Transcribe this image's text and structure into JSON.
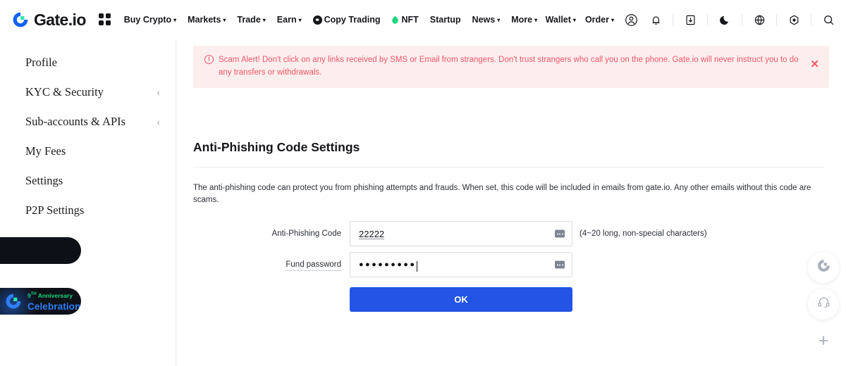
{
  "brand": {
    "name": "Gate.io",
    "logo_icon": "gate-logo-icon"
  },
  "topnav": {
    "apps_icon": "apps-grid-icon",
    "links": [
      {
        "label": "Buy Crypto",
        "caret": "▾",
        "icon": ""
      },
      {
        "label": "Markets",
        "caret": "▾",
        "icon": ""
      },
      {
        "label": "Trade",
        "caret": "▾",
        "icon": ""
      },
      {
        "label": "Earn",
        "caret": "▾",
        "icon": ""
      },
      {
        "label": "Copy Trading",
        "caret": "",
        "icon": "copy-trading-icon"
      },
      {
        "label": "NFT",
        "caret": "",
        "icon": "nft-flame-icon"
      },
      {
        "label": "Startup",
        "caret": "",
        "icon": ""
      },
      {
        "label": "News",
        "caret": "▾",
        "icon": ""
      },
      {
        "label": "More",
        "caret": "▾",
        "icon": ""
      }
    ],
    "right_links": [
      {
        "label": "Wallet",
        "caret": "▾"
      },
      {
        "label": "Order",
        "caret": "▾"
      }
    ],
    "right_icons": [
      "user-avatar-icon",
      "bell-icon",
      "download-icon",
      "moon-icon",
      "globe-icon",
      "hexagon-icon",
      "search-icon"
    ]
  },
  "sidebar": {
    "items": [
      {
        "label": "Profile",
        "chevron": ""
      },
      {
        "label": "KYC & Security",
        "chevron": "‹"
      },
      {
        "label": "Sub-accounts & APIs",
        "chevron": "‹"
      },
      {
        "label": "My Fees",
        "chevron": ""
      },
      {
        "label": "Settings",
        "chevron": ""
      },
      {
        "label": "P2P Settings",
        "chevron": ""
      }
    ],
    "banner": {
      "anniversary_number": "9",
      "anniversary_sup": "TH",
      "anniversary_word": "Anniversary",
      "celebration": "Celebration"
    }
  },
  "alert": {
    "icon": "exclamation-circle-icon",
    "text": "Scam Alert! Don't click on any links received by SMS or Email from strangers. Don't trust strangers who call you on the phone. Gate.io will never instruct you to do any transfers or withdrawals.",
    "close_label": "✕"
  },
  "main": {
    "title": "Anti-Phishing Code Settings",
    "description": "The anti-phishing code can protect you from phishing attempts and frauds. When set, this code will be included in emails from gate.io. Any other emails without this code are scams.",
    "fields": {
      "anti_phishing": {
        "label": "Anti-Phishing Code",
        "value": "22222",
        "placeholder": "",
        "hint": "(4~20 long, non-special characters)",
        "icon": "password-manager-icon"
      },
      "fund_password": {
        "label": "Fund password",
        "value": "●●●●●●●●●",
        "placeholder": "",
        "icon": "password-manager-icon"
      }
    },
    "submit_label": "OK"
  },
  "rail": {
    "buttons": [
      {
        "icon": "gate-logo-icon",
        "label": ""
      },
      {
        "icon": "headset-support-icon",
        "label": ""
      },
      {
        "icon": "plus-icon",
        "label": "+"
      }
    ]
  },
  "colors": {
    "brand_blue": "#1263f5",
    "brand_green": "#17d57e",
    "accent_button": "#2354e6",
    "alert_bg": "#fdeeee",
    "alert_text": "#f0576a"
  }
}
